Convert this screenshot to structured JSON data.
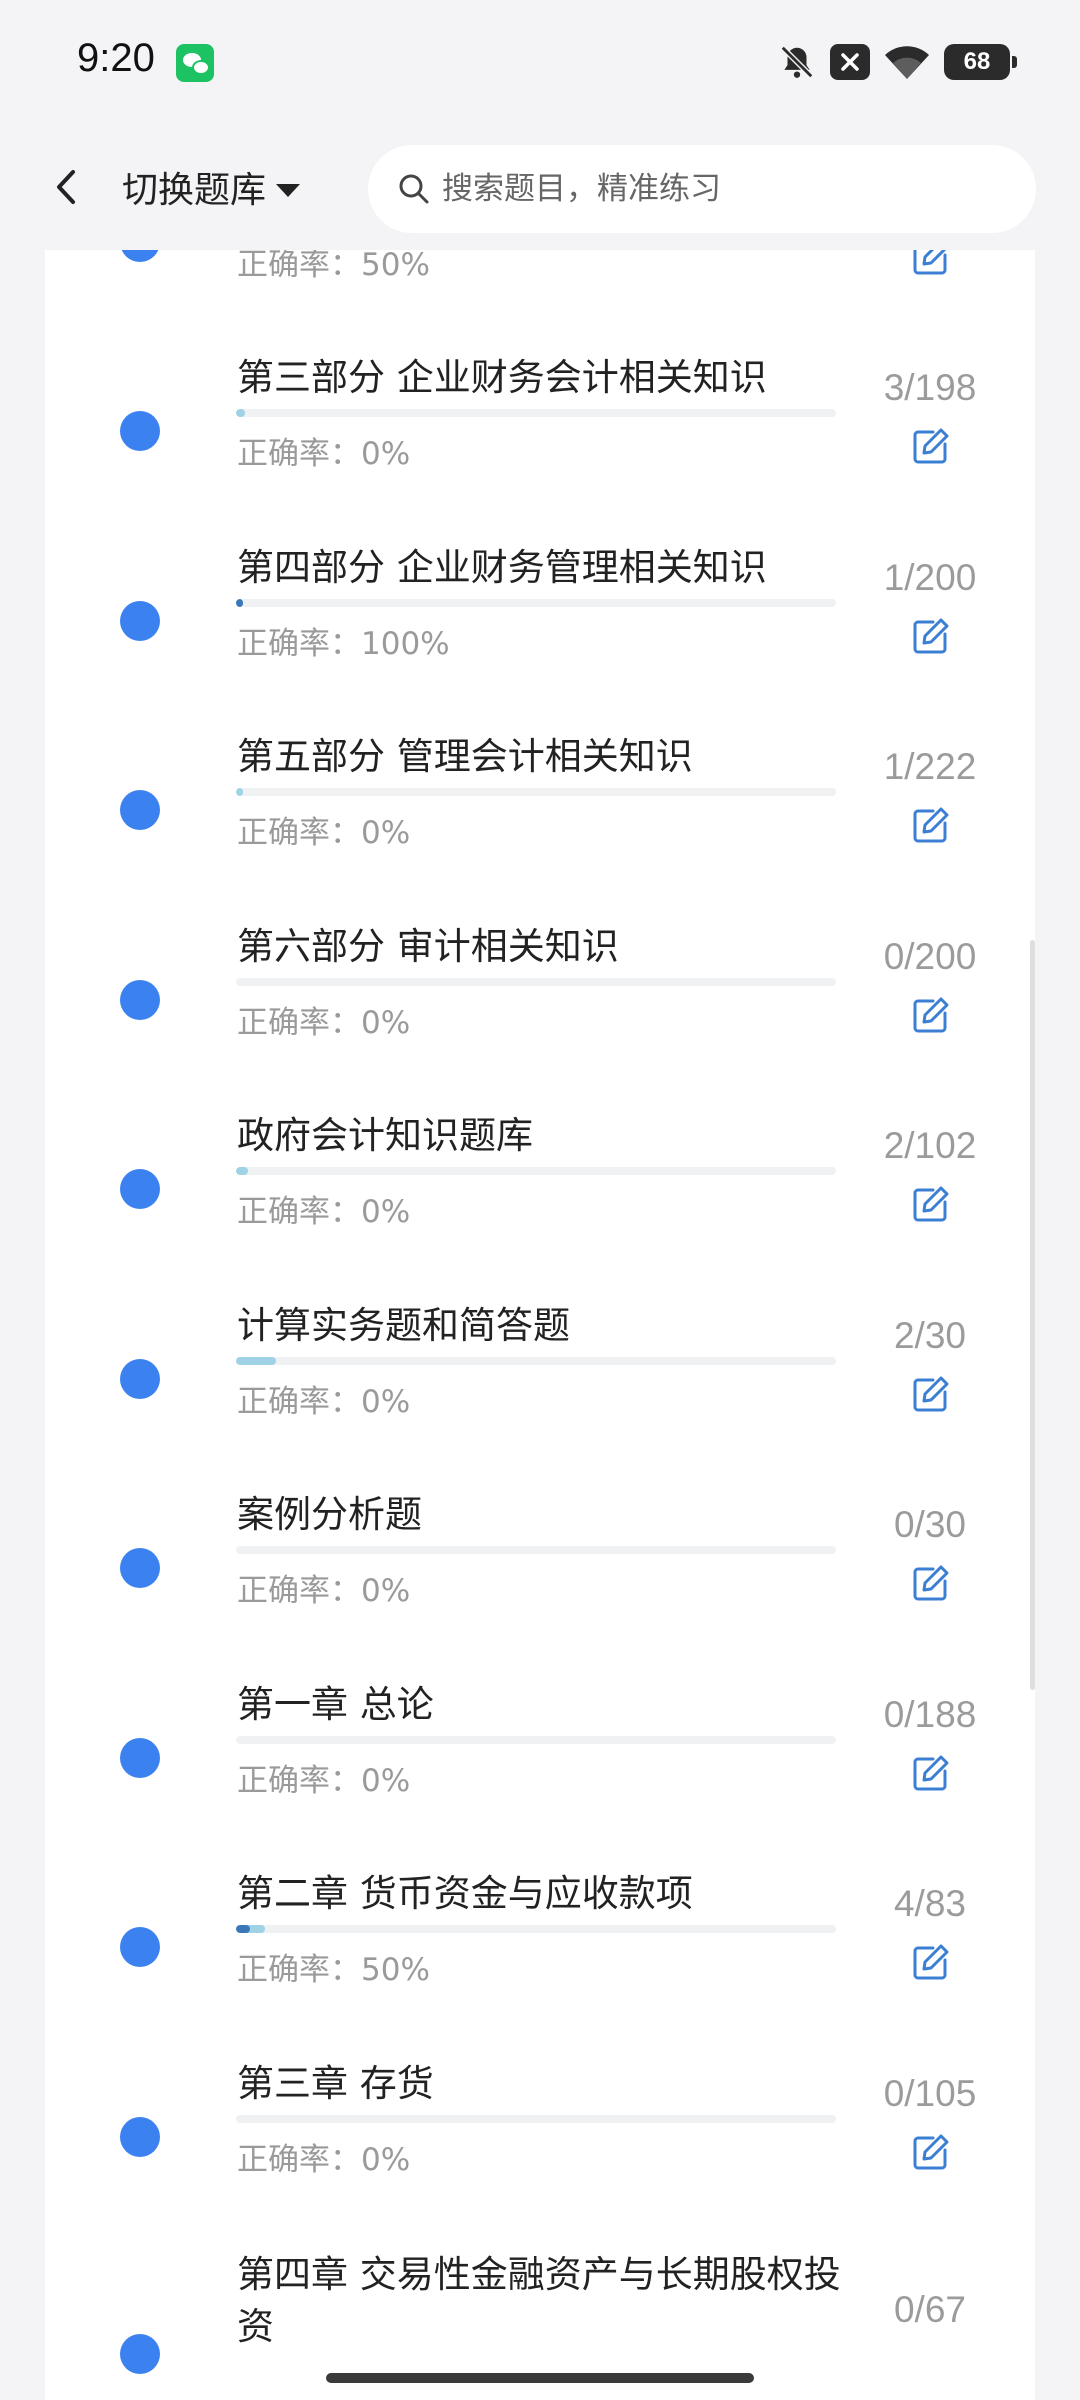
{
  "status_bar": {
    "time": "9:20",
    "battery": "68"
  },
  "topbar": {
    "switch_label": "切换题库",
    "search_placeholder": "搜索题目，精准练习"
  },
  "items": [
    {
      "title": "",
      "accuracy": "正确率：50%",
      "count": "",
      "progress": 0.01,
      "correct_ratio": 0.5
    },
    {
      "title": "第三部分 企业财务会计相关知识",
      "accuracy": "正确率：0%",
      "count": "3/198",
      "progress": 0.015,
      "correct_ratio": 0
    },
    {
      "title": "第四部分 企业财务管理相关知识",
      "accuracy": "正确率：100%",
      "count": "1/200",
      "progress": 0.005,
      "correct_ratio": 1
    },
    {
      "title": "第五部分 管理会计相关知识",
      "accuracy": "正确率：0%",
      "count": "1/222",
      "progress": 0.0045,
      "correct_ratio": 0
    },
    {
      "title": "第六部分 审计相关知识",
      "accuracy": "正确率：0%",
      "count": "0/200",
      "progress": 0,
      "correct_ratio": 0
    },
    {
      "title": "政府会计知识题库",
      "accuracy": "正确率：0%",
      "count": "2/102",
      "progress": 0.02,
      "correct_ratio": 0
    },
    {
      "title": "计算实务题和简答题",
      "accuracy": "正确率：0%",
      "count": "2/30",
      "progress": 0.067,
      "correct_ratio": 0
    },
    {
      "title": "案例分析题",
      "accuracy": "正确率：0%",
      "count": "0/30",
      "progress": 0,
      "correct_ratio": 0
    },
    {
      "title": "第一章 总论",
      "accuracy": "正确率：0%",
      "count": "0/188",
      "progress": 0,
      "correct_ratio": 0
    },
    {
      "title": "第二章 货币资金与应收款项",
      "accuracy": "正确率：50%",
      "count": "4/83",
      "progress": 0.048,
      "correct_ratio": 0.5
    },
    {
      "title": "第三章 存货",
      "accuracy": "正确率：0%",
      "count": "0/105",
      "progress": 0,
      "correct_ratio": 0
    },
    {
      "title": "第四章 交易性金融资产与长期股权投资",
      "accuracy": "",
      "count": "0/67",
      "progress": 0,
      "correct_ratio": 0
    }
  ],
  "colors": {
    "dot": "#3b82f0",
    "progress_light": "#9fd2e4",
    "progress_dark": "#3a79b8",
    "edit_icon": "#3b7fd4"
  }
}
